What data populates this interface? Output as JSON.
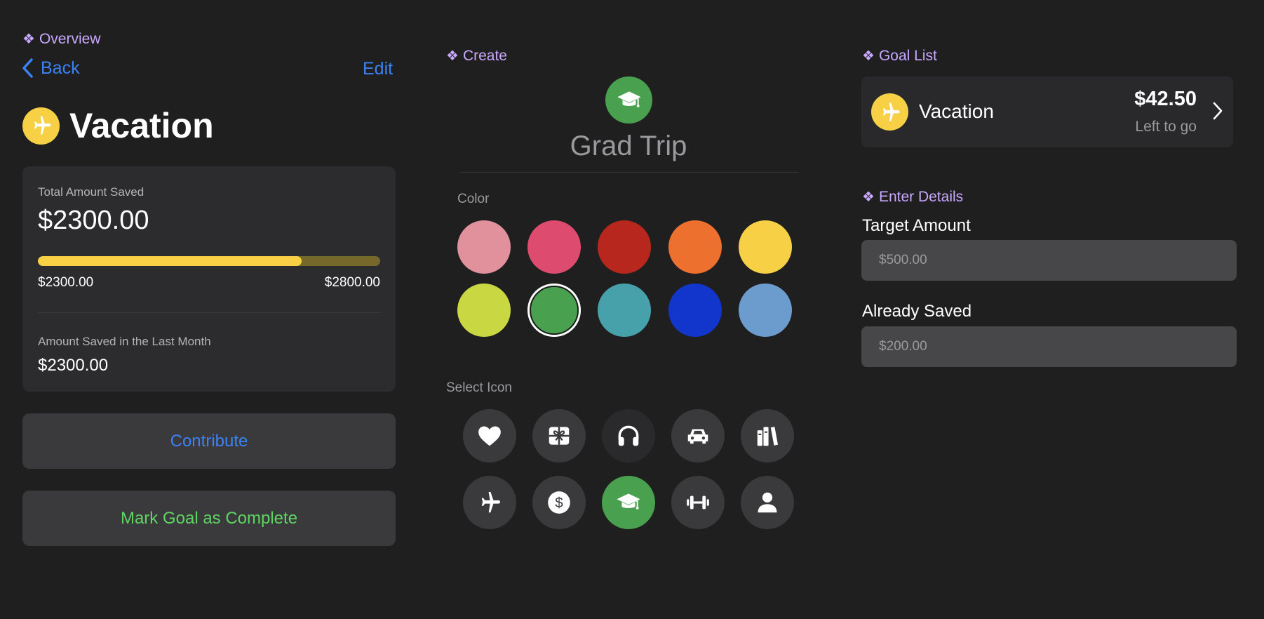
{
  "left": {
    "section_label": "Overview",
    "back_label": "Back",
    "edit_label": "Edit",
    "goal_title": "Vacation",
    "goal_icon": "airplane-icon",
    "total_label": "Total Amount Saved",
    "total_value": "$2300.00",
    "progress_fraction": 0.7714,
    "progress_start": "$2300.00",
    "progress_end": "$2800.00",
    "last_month_label": "Amount Saved in the Last Month",
    "last_month_value": "$2300.00",
    "contribute_label": "Contribute",
    "complete_label": "Mark Goal as Complete"
  },
  "create": {
    "section_label": "Create",
    "goal_name": "Grad Trip",
    "selected_icon": "graduation-cap-icon",
    "color_label": "Color",
    "colors": [
      "#e0919c",
      "#dd4c6e",
      "#b8271e",
      "#ed702f",
      "#f7d046",
      "#c9d743",
      "#49a04f",
      "#47a1ab",
      "#1235cc",
      "#6c9bcd"
    ],
    "selected_color_index": 6,
    "icon_label": "Select Icon",
    "icons": [
      "heart-icon",
      "gift-icon",
      "headphones-icon",
      "car-icon",
      "books-icon",
      "airplane-icon",
      "dollar-icon",
      "graduation-cap-icon",
      "dumbbell-icon",
      "person-icon"
    ],
    "selected_icon_index": 7
  },
  "goal_list": {
    "section_label": "Goal List",
    "items": [
      {
        "name": "Vacation",
        "amount": "$42.50",
        "sub": "Left to go",
        "icon": "airplane-icon",
        "color": "#f7d046"
      }
    ]
  },
  "details": {
    "section_label": "Enter Details",
    "target_label": "Target Amount",
    "target_placeholder": "$500.00",
    "saved_label": "Already Saved",
    "saved_placeholder": "$200.00"
  },
  "colors": {
    "accent_blue": "#3b82f6",
    "accent_green": "#5fd463",
    "section_purple": "#c9a8ff",
    "yellow": "#f7d046"
  }
}
